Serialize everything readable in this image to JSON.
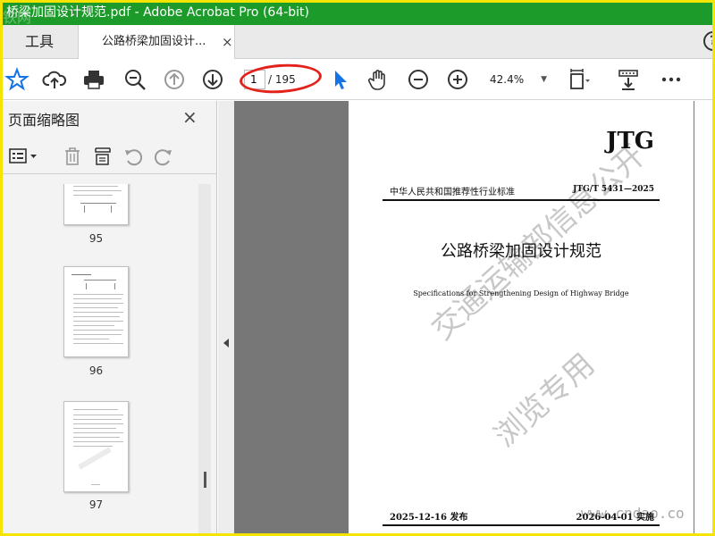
{
  "window": {
    "title": "桥梁加固设计规范.pdf - Adobe Acrobat Pro (64-bit)",
    "title_watermark": "铁网"
  },
  "tabs": {
    "tools_label": "工具",
    "doc_label": "公路桥梁加固设计...",
    "close_glyph": "×",
    "help_glyph": "?"
  },
  "toolbar": {
    "current_page": "1",
    "page_total": "/ 195",
    "zoom": "42.4%"
  },
  "left_pane": {
    "title": "页面缩略图",
    "close_glyph": "×",
    "thumbnails": [
      {
        "page": "95"
      },
      {
        "page": "96"
      },
      {
        "page": "97"
      }
    ]
  },
  "document": {
    "logo": "JTG",
    "standard_name": "中华人民共和国推荐性行业标准",
    "standard_code": "JTG/T 5431—2025",
    "title_cn": "公路桥梁加固设计规范",
    "title_en": "Specifications for Strengthening Design of Highway Bridge",
    "watermark_line1": "交通运输部信息公开",
    "watermark_line2": "浏览专用",
    "release_date": "2025-12-16  发布",
    "implement_date": "2026-04-01  实施"
  },
  "site_watermark": "www.cndao.co",
  "colors": {
    "title_bar": "#1c9b2a",
    "highlight_ring": "#e3221c",
    "frame": "#f5e400",
    "accent_blue": "#1473e6"
  }
}
